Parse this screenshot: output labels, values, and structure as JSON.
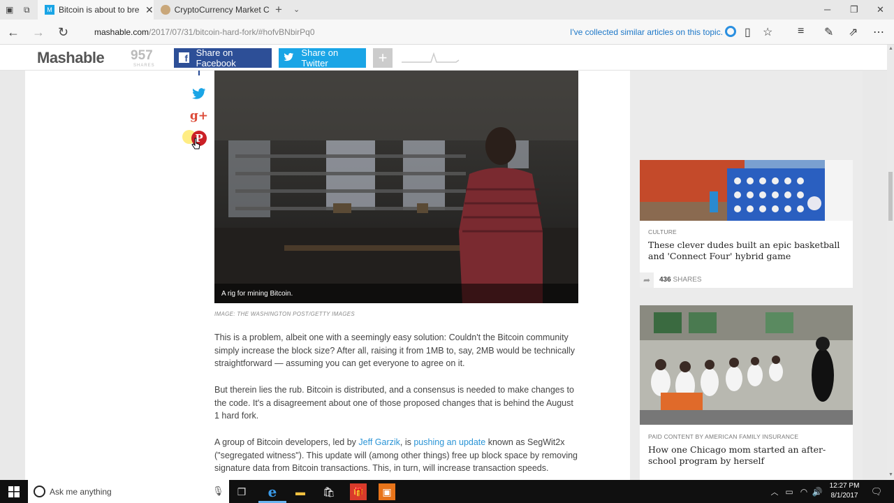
{
  "browser": {
    "tabs": [
      {
        "title": "Bitcoin is about to breal",
        "active": true
      },
      {
        "title": "CryptoCurrency Market Cap",
        "active": false
      }
    ],
    "url_host": "mashable.com",
    "url_path": "/2017/07/31/bitcoin-hard-fork/#hofvBNbirPq0",
    "collected_note": "I've collected similar articles on this topic."
  },
  "header": {
    "logo": "Mashable",
    "shares_count": "957",
    "shares_label": "SHARES",
    "facebook_label": "Share on Facebook",
    "twitter_label": "Share on Twitter",
    "plus_label": "+"
  },
  "article": {
    "photo_caption": "A rig for mining Bitcoin.",
    "photo_credit": "IMAGE: THE WASHINGTON POST/GETTY IMAGES",
    "p1": "This is a problem, albeit one with a seemingly easy solution: Couldn't the Bitcoin community simply increase the block size? After all, raising it from 1MB to, say, 2MB would be technically straightforward — assuming you can get everyone to agree on it.",
    "p2": "But therein lies the rub. Bitcoin is distributed, and a consensus is needed to make changes to the code. It's a disagreement about one of those proposed changes that is behind the August 1 hard fork.",
    "p3_a": "A group of Bitcoin developers, led by ",
    "p3_link1": "Jeff Garzik",
    "p3_b": ", is ",
    "p3_link2": "pushing an update",
    "p3_c": " known as SegWit2x (\"segregated witness\"). This update will (among other things) free up block space by removing signature data from Bitcoin transactions. This, in turn, will increase transaction speeds."
  },
  "sidebar": {
    "card1": {
      "category": "CULTURE",
      "title": "These clever dudes built an epic basketball and 'Connect Four' hybrid game",
      "shares_count": "436",
      "shares_label": "SHARES"
    },
    "card2": {
      "category": "PAID CONTENT BY AMERICAN FAMILY INSURANCE",
      "title": "How one Chicago mom started an after-school program by herself"
    }
  },
  "taskbar": {
    "search_placeholder": "Ask me anything",
    "time": "12:27 PM",
    "date": "8/1/2017"
  },
  "colors": {
    "facebook": "#2d4f97",
    "twitter": "#1aa5e6",
    "link": "#2a94d6",
    "pinterest": "#cb2027",
    "googleplus": "#dd4b39"
  }
}
